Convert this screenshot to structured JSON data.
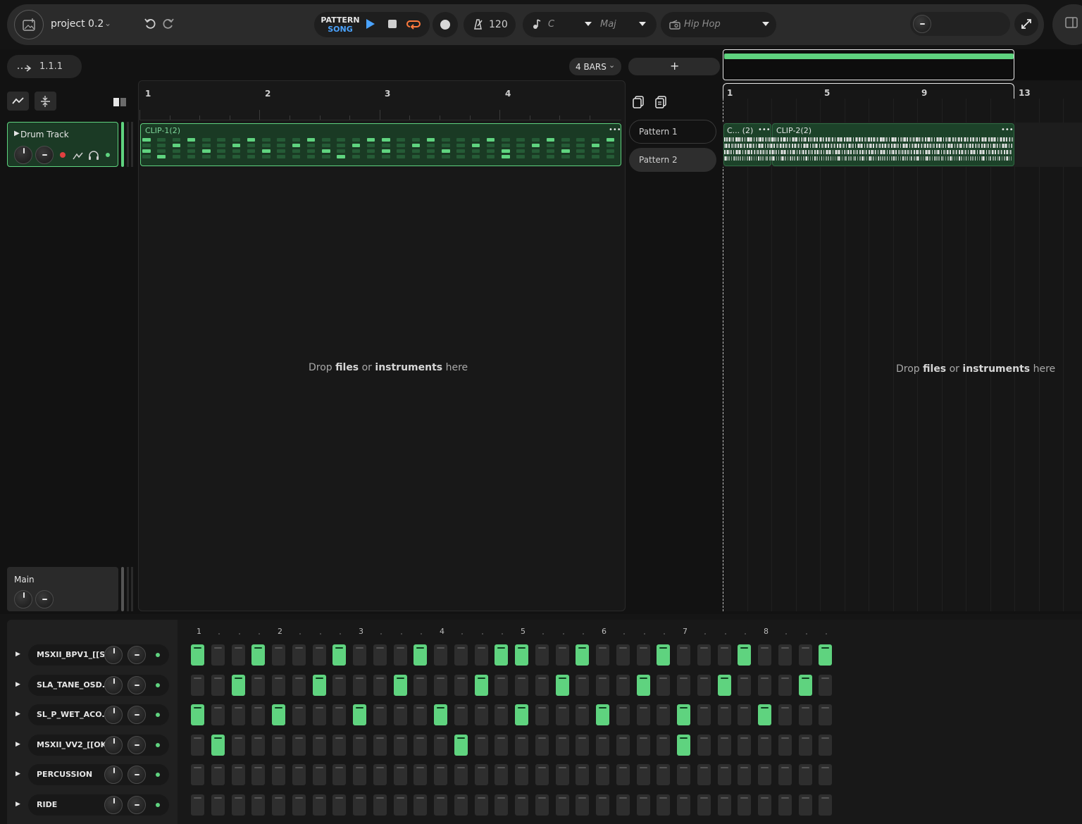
{
  "header": {
    "project_name": "project 0.2",
    "mode_pattern": "PATTERN",
    "mode_song": "SONG",
    "tempo": "120",
    "key": "C",
    "scale": "Maj",
    "genre": "Hip Hop"
  },
  "position": "1.1.1",
  "bars_select": "4 BARS",
  "add_label": "+",
  "pattern_editor": {
    "ruler": [
      "1",
      "2",
      "3",
      "4"
    ],
    "clip_title": "CLIP-1(2)",
    "clip_menu": "•••",
    "drop_a": "Drop ",
    "drop_files": "files",
    "drop_or": " or ",
    "drop_instruments": "instruments",
    "drop_here": " here"
  },
  "track": {
    "name": "Drum Track",
    "main_label": "Main"
  },
  "patterns": [
    "Pattern 1",
    "Pattern 2"
  ],
  "song": {
    "ruler": [
      "1",
      "5",
      "9",
      "13"
    ],
    "clip_a_title": "C... (2)",
    "clip_b_title": "CLIP-2(2)",
    "clip_menu": "•••"
  },
  "sequencer": {
    "beats": [
      "1",
      "2",
      "3",
      "4",
      "5",
      "6",
      "7",
      "8"
    ],
    "rows": [
      {
        "name": "MSXII_BPV1_[[S...",
        "steps": [
          1,
          0,
          0,
          1,
          0,
          0,
          0,
          1,
          0,
          0,
          0,
          1,
          0,
          0,
          0,
          1,
          1,
          0,
          0,
          1,
          0,
          0,
          0,
          1,
          0,
          0,
          0,
          1,
          0,
          0,
          0,
          1
        ]
      },
      {
        "name": "SLA_TANE_OSD...",
        "steps": [
          0,
          0,
          1,
          0,
          0,
          0,
          1,
          0,
          0,
          0,
          1,
          0,
          0,
          0,
          1,
          0,
          0,
          0,
          1,
          0,
          0,
          0,
          1,
          0,
          0,
          0,
          1,
          0,
          0,
          0,
          1,
          0
        ]
      },
      {
        "name": "SL_P_WET_ACO...",
        "steps": [
          1,
          0,
          0,
          0,
          1,
          0,
          0,
          0,
          1,
          0,
          0,
          0,
          1,
          0,
          0,
          0,
          1,
          0,
          0,
          0,
          1,
          0,
          0,
          0,
          1,
          0,
          0,
          0,
          1,
          0,
          0,
          0
        ]
      },
      {
        "name": "MSXII_VV2_[[OK...",
        "steps": [
          0,
          1,
          0,
          0,
          0,
          0,
          0,
          0,
          0,
          0,
          0,
          0,
          0,
          1,
          0,
          0,
          0,
          0,
          0,
          0,
          0,
          0,
          0,
          0,
          1,
          0,
          0,
          0,
          0,
          0,
          0,
          0
        ]
      },
      {
        "name": "PERCUSSION",
        "steps": [
          0,
          0,
          0,
          0,
          0,
          0,
          0,
          0,
          0,
          0,
          0,
          0,
          0,
          0,
          0,
          0,
          0,
          0,
          0,
          0,
          0,
          0,
          0,
          0,
          0,
          0,
          0,
          0,
          0,
          0,
          0,
          0
        ]
      },
      {
        "name": "RIDE",
        "steps": [
          0,
          0,
          0,
          0,
          0,
          0,
          0,
          0,
          0,
          0,
          0,
          0,
          0,
          0,
          0,
          0,
          0,
          0,
          0,
          0,
          0,
          0,
          0,
          0,
          0,
          0,
          0,
          0,
          0,
          0,
          0,
          0
        ]
      }
    ]
  },
  "colors": {
    "accent": "#5fd37f",
    "play": "#4aa3ff",
    "loop": "#ff7a3d",
    "record": "#e04040"
  }
}
